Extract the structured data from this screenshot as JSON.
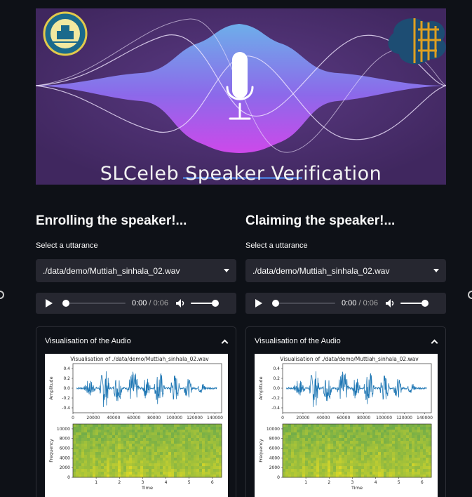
{
  "banner": {
    "title": "SLCeleb Speaker Verification",
    "left_logo": "university-seal-logo",
    "right_logo": "brain-lab-logo",
    "icon": "microphone-icon",
    "colors": {
      "background": "#4a2c6b",
      "wave_top": "#6fb5f0",
      "wave_bottom": "#d44af0"
    }
  },
  "enroll": {
    "heading": "Enrolling the speaker!...",
    "select_label": "Select a uttarance",
    "selected_file": "./data/demo/Muttiah_sinhala_02.wav",
    "player": {
      "current": "0:00",
      "separator": " / ",
      "duration": "0:06",
      "progress": 0.0,
      "volume": 1.0
    },
    "expander": {
      "title": "Visualisation of the Audio",
      "expanded": true
    }
  },
  "claim": {
    "heading": "Claiming the speaker!...",
    "select_label": "Select a uttarance",
    "selected_file": "./data/demo/Muttiah_sinhala_02.wav",
    "player": {
      "current": "0:00",
      "separator": " / ",
      "duration": "0:06",
      "progress": 0.0,
      "volume": 1.0
    },
    "expander": {
      "title": "Visualisation of the Audio",
      "expanded": true
    }
  },
  "chart_data": [
    {
      "type": "line",
      "title": "Visualisation of ./data/demo/Muttiah_sinhala_02.wav",
      "xlabel": "",
      "ylabel": "Amplitude",
      "xlim": [
        0,
        140000
      ],
      "ylim": [
        -0.5,
        0.5
      ],
      "x_ticks": [
        "0",
        "20000",
        "40000",
        "60000",
        "80000",
        "100000",
        "120000",
        "140000"
      ],
      "y_ticks": [
        "0.4",
        "0.2",
        "0.0",
        "-0.2",
        "-0.4"
      ]
    },
    {
      "type": "heatmap",
      "title": "",
      "xlabel": "Time",
      "ylabel": "Frequency",
      "xlim": [
        0,
        6.4
      ],
      "ylim": [
        0,
        11000
      ],
      "x_ticks": [
        "1",
        "2",
        "3",
        "4",
        "5",
        "6"
      ],
      "y_ticks": [
        "10000",
        "8000",
        "6000",
        "4000",
        "2000",
        "0"
      ]
    }
  ]
}
